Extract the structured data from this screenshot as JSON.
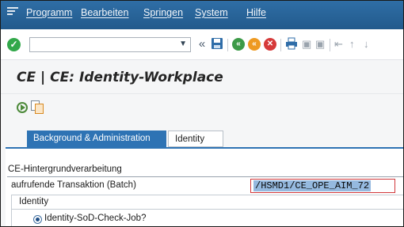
{
  "menu": {
    "items": [
      "Programm",
      "Bearbeiten",
      "Springen",
      "System",
      "Hilfe"
    ]
  },
  "toolbar": {
    "command_field_value": "",
    "icons": [
      "ok-check-icon",
      "dropdown-caret-icon",
      "back-double-arrow-icon",
      "save-icon",
      "back-icon",
      "exit-icon",
      "cancel-icon",
      "print-icon",
      "find-icon",
      "find-next-icon",
      "first-page-icon",
      "previous-page-icon",
      "next-page-icon"
    ]
  },
  "title": "CE | CE: Identity-Workplace",
  "tabs": [
    {
      "label": "Background & Administration",
      "active": true
    },
    {
      "label": "Identity",
      "active": false
    }
  ],
  "group": {
    "title": "CE-Hintergrundverarbeitung",
    "field_label": "aufrufende Transaktion (Batch)",
    "field_value": "/HSMD1/CE_OPE_AIM_72",
    "subgroup": {
      "title": "Identity",
      "radio_label": "Identity-SoD-Check-Job?",
      "radio_selected": true
    }
  },
  "colors": {
    "menubar": "#2a6399",
    "active_tab": "#2e73b4",
    "ok_icon": "#32a84a",
    "field_border_error": "#d1373a"
  }
}
